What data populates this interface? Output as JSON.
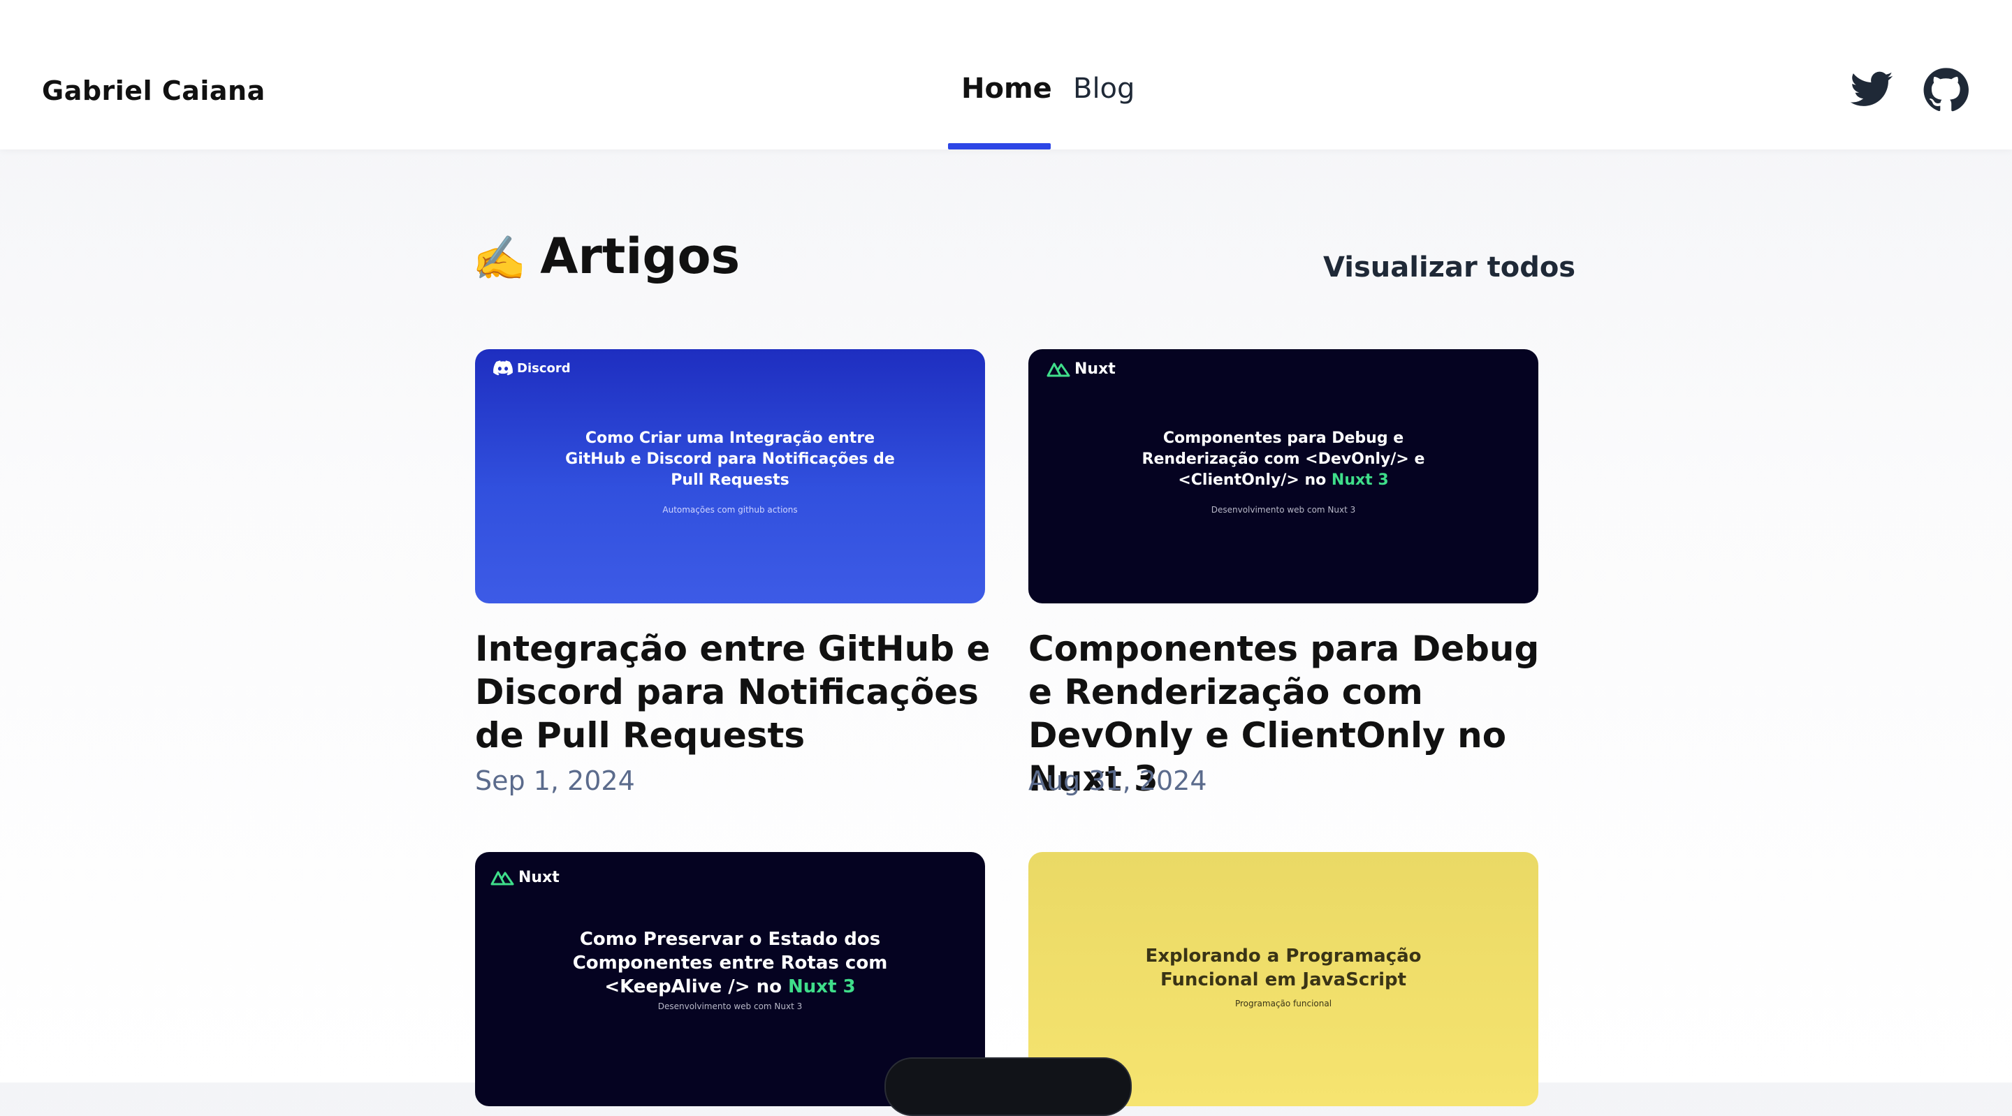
{
  "header": {
    "brand": "Gabriel Caiana",
    "nav": [
      {
        "label": "Home",
        "active": true
      },
      {
        "label": "Blog",
        "active": false
      }
    ],
    "accent_color": "#2d46e6",
    "social_icons": [
      "twitter-icon",
      "github-icon"
    ]
  },
  "section": {
    "emoji": "✍️",
    "title": "Artigos",
    "view_all": "Visualizar todos"
  },
  "posts": [
    {
      "thumb_logo": "Discord",
      "thumb_title_lines": [
        "Como Criar uma Integração entre",
        "GitHub e Discord para Notificações de",
        "Pull Requests"
      ],
      "thumb_subtitle": "Automações com github actions",
      "title": "Integração entre GitHub e Discord para Notificações de Pull Requests",
      "date": "Sep 1, 2024"
    },
    {
      "thumb_logo": "Nuxt",
      "thumb_title_lines": [
        "Componentes para Debug e",
        "Renderização com <DevOnly/> e"
      ],
      "thumb_title_last": "<ClientOnly/> no ",
      "thumb_title_highlight": "Nuxt 3",
      "thumb_subtitle": "Desenvolvimento web com Nuxt 3",
      "title": "Componentes para Debug e Renderização com DevOnly e ClientOnly no Nuxt 3",
      "date": "Aug 31, 2024"
    },
    {
      "thumb_logo": "Nuxt",
      "thumb_title_lines": [
        "Como Preservar o Estado dos",
        "Componentes entre Rotas com"
      ],
      "thumb_title_last": "<KeepAlive /> no ",
      "thumb_title_highlight": "Nuxt 3",
      "thumb_subtitle": "Desenvolvimento web com Nuxt 3"
    },
    {
      "thumb_title_lines": [
        "Explorando a Programação",
        "Funcional em JavaScript"
      ],
      "thumb_subtitle": "Programação funcional"
    }
  ]
}
